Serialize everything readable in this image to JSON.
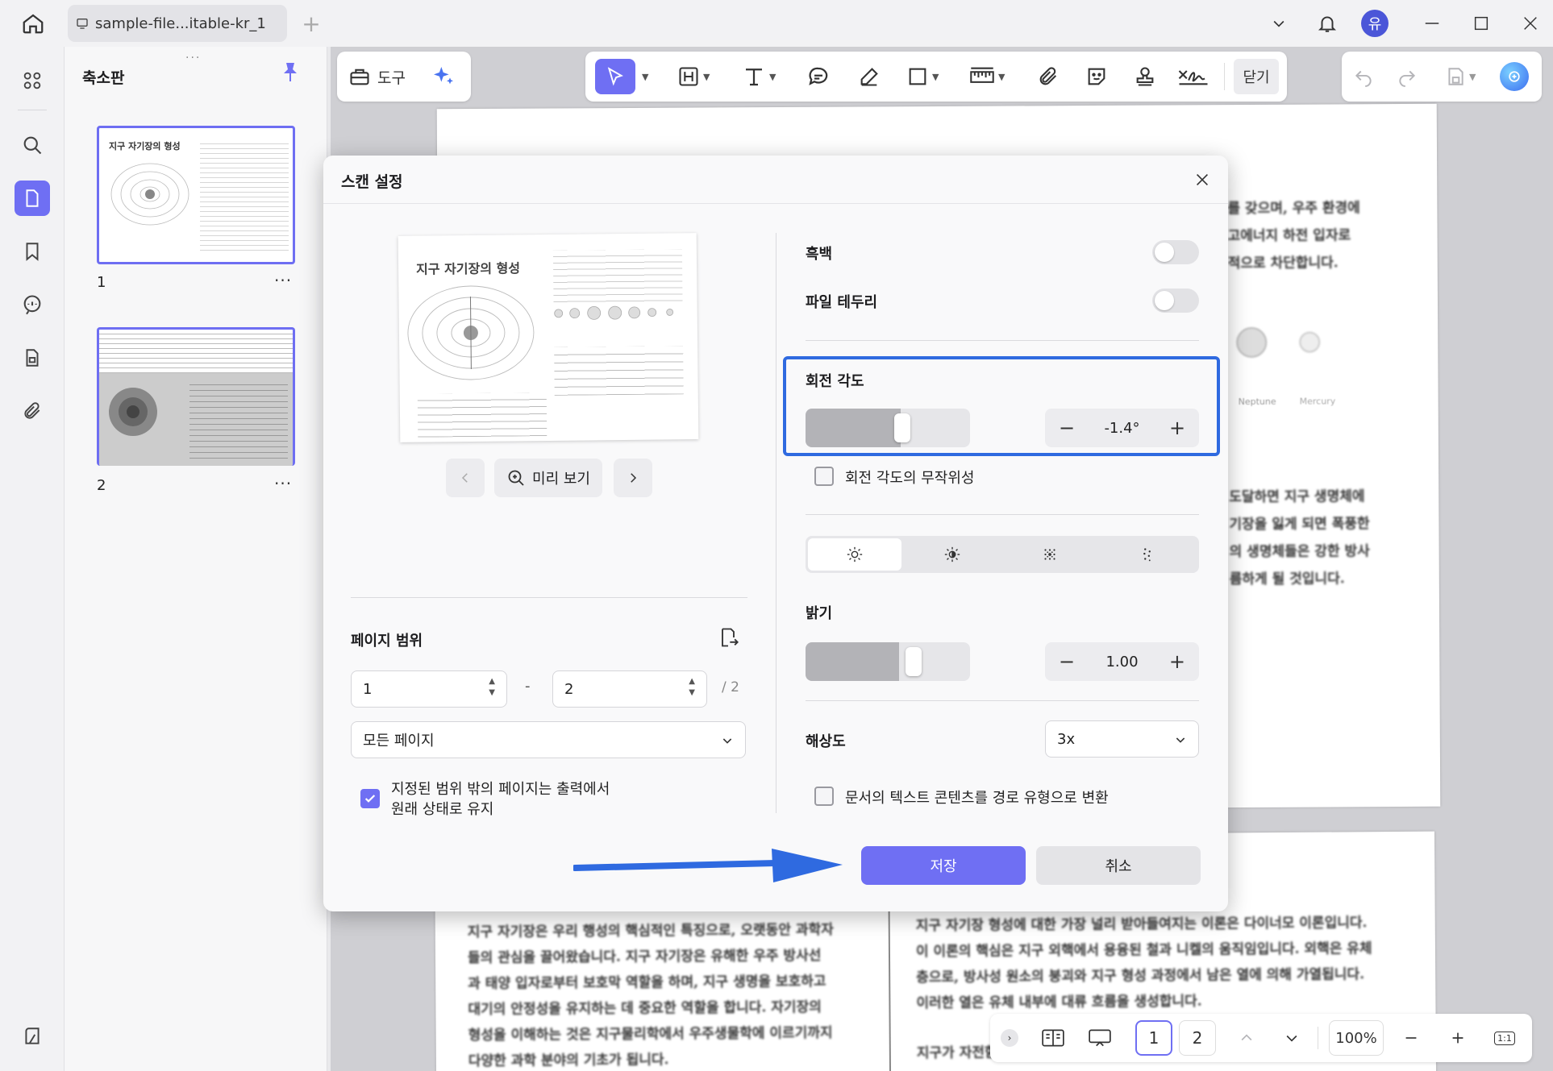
{
  "titlebar": {
    "file_tab": "sample-file...itable-kr_1",
    "avatar_initial": "유"
  },
  "thumbnails": {
    "title": "축소판",
    "pages": [
      "1",
      "2"
    ],
    "more": "···",
    "page1_heading": "지구 자기장의 형성"
  },
  "toolbar": {
    "tools_label": "도구",
    "close_label": "닫기"
  },
  "document": {
    "upper_lines": [
      "를 갖으며, 우주 환경에",
      "고에너지 하전 입자로",
      "적으로 차단합니다."
    ],
    "planet_labels": [
      "Neptune",
      "Mercury"
    ],
    "mid_lines": [
      "도달하면 지구 생명체에",
      "기장을 잃게 되면 폭풍한",
      "의 생명체들은 강한 방사",
      "름하게 될 것입니다."
    ],
    "left_col": [
      "지구 자기장은 우리 행성의 핵심적인 특징으로, 오랫동안 과학자",
      "들의 관심을 끌어왔습니다. 지구 자기장은 유해한 우주 방사선",
      "과 태양 입자로부터 보호막 역할을 하며, 지구 생명을 보호하고",
      "대기의 안정성을 유지하는 데 중요한 역할을 합니다. 자기장의",
      "형성을 이해하는 것은 지구물리학에서 우주생물학에 이르기까지",
      "다양한 과학 분야의 기초가 됩니다."
    ],
    "right_col": [
      "지구 자기장 형성에 대한 가장 널리 받아들여지는 이론은 다이너모 이론입니다.",
      "이 이론의 핵심은 지구 외핵에서 용융된 철과 니켈의 움직임입니다. 외핵은 유체",
      "층으로, 방사성 원소의 붕괴와 지구 형성 과정에서 남은 열에 의해 가열됩니다.",
      "이러한 열은 유체 내부에 대류 흐름을 생성합니다.",
      "지구가 자전함에 따라 코리올리 효과가 대류 흐름에 영향을"
    ]
  },
  "modal": {
    "title": "스캔 설정",
    "preview_label": "미리 보기",
    "preview_heading": "지구 자기장의 형성",
    "page_range_label": "페이지 범위",
    "range_from": "1",
    "range_to": "2",
    "range_sep": "-",
    "range_total": "/ 2",
    "page_select": "모든 페이지",
    "keep_outside_line1": "지정된 범위 밖의 페이지는 출력에서",
    "keep_outside_line2": "원래 상태로 유지",
    "keep_outside_checked": true,
    "bw_label": "흑백",
    "bw_on": false,
    "border_label": "파일 테두리",
    "border_on": false,
    "rotation_label": "회전 각도",
    "rotation_value": "-1.4°",
    "rotation_random_label": "회전 각도의 무작위성",
    "rotation_random_checked": false,
    "brightness_label": "밝기",
    "brightness_value": "1.00",
    "resolution_label": "해상도",
    "resolution_value": "3x",
    "convert_text_label": "문서의 텍스트 콘텐츠를 경로 유형으로 변환",
    "convert_text_checked": false,
    "save_label": "저장",
    "cancel_label": "취소",
    "highlight_color": "#2f6ae0",
    "accent_color": "#6f6ff3"
  },
  "bottombar": {
    "page1": "1",
    "page2": "2",
    "zoom": "100%",
    "fit": "1:1"
  }
}
